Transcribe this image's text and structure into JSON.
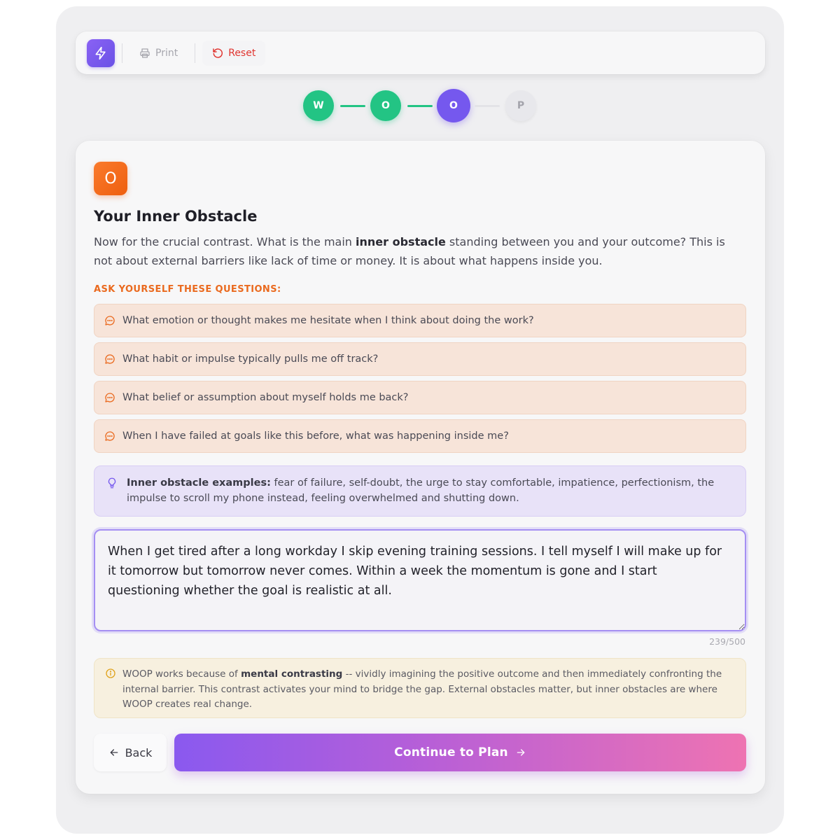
{
  "toolbar": {
    "print_label": "Print",
    "reset_label": "Reset"
  },
  "stepper": {
    "steps": [
      {
        "letter": "W",
        "state": "done"
      },
      {
        "letter": "O",
        "state": "done"
      },
      {
        "letter": "O",
        "state": "current"
      },
      {
        "letter": "P",
        "state": "todo"
      }
    ]
  },
  "card": {
    "badge": "O",
    "title": "Your Inner Obstacle",
    "intro_before": "Now for the crucial contrast. What is the main ",
    "intro_bold": "inner obstacle",
    "intro_after": " standing between you and your outcome? This is not about external barriers like lack of time or money. It is about what happens inside you.",
    "ask_label": "ASK YOURSELF THESE QUESTIONS:",
    "questions": [
      "What emotion or thought makes me hesitate when I think about doing the work?",
      "What habit or impulse typically pulls me off track?",
      "What belief or assumption about myself holds me back?",
      "When I have failed at goals like this before, what was happening inside me?"
    ],
    "examples_label": "Inner obstacle examples:",
    "examples_text": " fear of failure, self-doubt, the urge to stay comfortable, impatience, perfectionism, the impulse to scroll my phone instead, feeling overwhelmed and shutting down.",
    "answer": "When I get tired after a long workday I skip evening training sessions. I tell myself I will make up for it tomorrow but tomorrow never comes. Within a week the momentum is gone and I start questioning whether the goal is realistic at all.",
    "counter": "239/500",
    "info_before": "WOOP works because of ",
    "info_bold": "mental contrasting",
    "info_after": " -- vividly imagining the positive outcome and then immediately confronting the internal barrier. This contrast activates your mind to bridge the gap. External obstacles matter, but inner obstacles are where WOOP creates real change.",
    "back_label": "Back",
    "continue_label": "Continue to Plan"
  },
  "colors": {
    "accent_purple": "#7558ee",
    "done_green": "#23c484",
    "obstacle_orange": "#ee5f0f",
    "reset_red": "#e0342f"
  },
  "icons": {
    "brand": "lightning-icon",
    "print": "printer-icon",
    "reset": "rotate-ccw-icon",
    "question": "message-bubble-icon",
    "examples": "lightbulb-icon",
    "info": "info-circle-icon",
    "back": "arrow-left-icon",
    "continue": "arrow-right-icon"
  }
}
